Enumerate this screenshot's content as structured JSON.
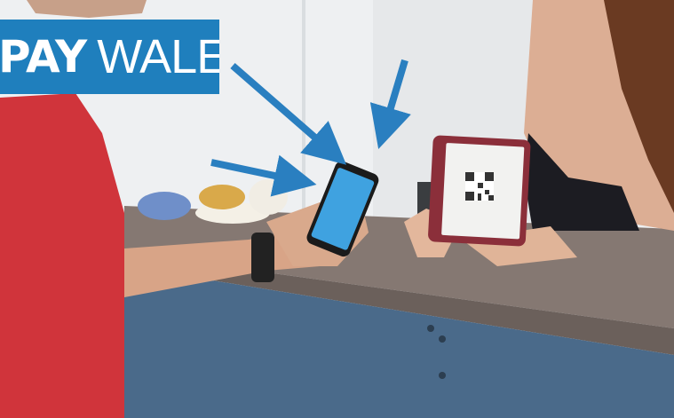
{
  "banner": {
    "word_bold": "PAY",
    "word_light": "WALET",
    "color": "#1f7fbd"
  },
  "colors": {
    "arrow": "#2a7fc0",
    "shirt": "#d0343b",
    "counter": "#857872",
    "wall": "#eef0f2"
  },
  "icons": [
    "arrow-icon",
    "qr-code-icon",
    "smartphone-icon",
    "tablet-icon",
    "wristwatch-icon"
  ]
}
